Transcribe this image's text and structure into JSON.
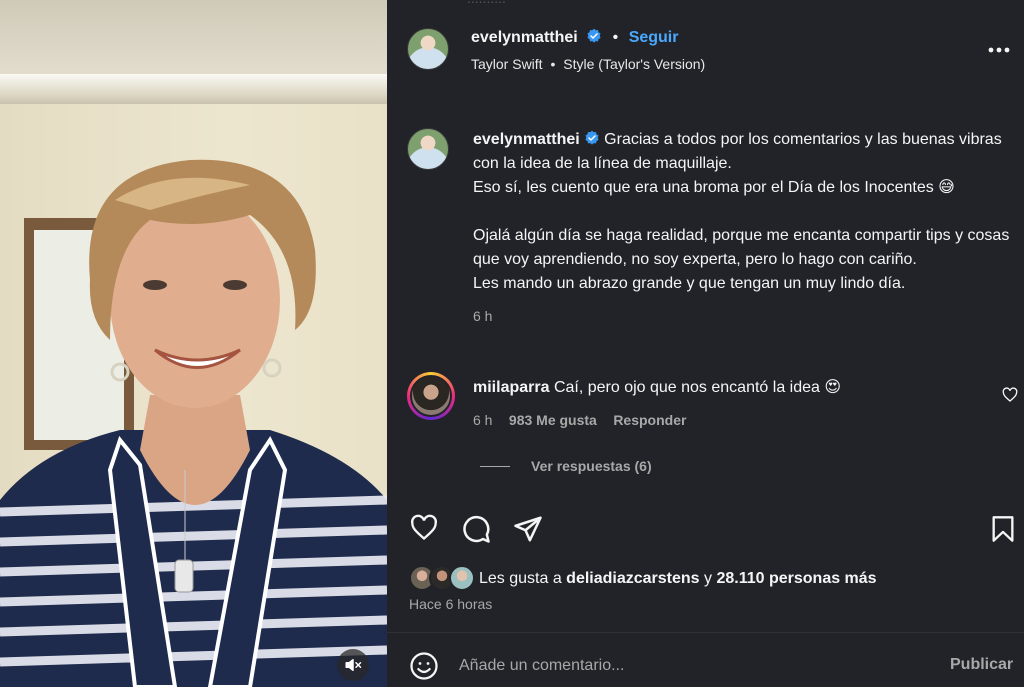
{
  "post": {
    "username": "evelynmatthei",
    "follow_label": "Seguir",
    "dot": "•",
    "music": {
      "artist": "Taylor Swift",
      "separator": "•",
      "track": "Style (Taylor's Version)"
    },
    "caption": {
      "username": "evelynmatthei",
      "line1": "Gracias a todos por los comentarios y las buenas vibras con la idea de la línea de maquillaje.",
      "line2": "Eso sí, les cuento que era una broma por el Día de los Inocentes 😅",
      "line3": "Ojalá algún día se haga realidad, porque me encanta compartir tips y cosas que voy aprendiendo, no soy experta, pero lo hago con cariño.",
      "line4": "Les mando un abrazo grande y que tengan un muy lindo día.",
      "time": "6 h"
    },
    "comment": {
      "username": "miilaparra",
      "text": "Caí, pero ojo que nos encantó la idea 😍",
      "time": "6 h",
      "likes": "983 Me gusta",
      "reply_label": "Responder",
      "view_replies": "Ver respuestas (6)"
    },
    "likes": {
      "prefix": "Les gusta a ",
      "user": "deliadiazcarstens",
      "middle": " y ",
      "count": "28.110 personas más"
    },
    "posted_ago": "Hace 6 horas",
    "composer": {
      "placeholder": "Añade un comentario...",
      "publish_label": "Publicar"
    }
  },
  "icons": {
    "verified": "verified-badge-icon",
    "more": "more-options-icon",
    "like": "heart-icon",
    "comment": "comment-icon",
    "share": "share-icon",
    "save": "bookmark-icon",
    "emoji": "emoji-icon",
    "mute": "muted-speaker-icon",
    "comment_like": "small-heart-icon"
  },
  "colors": {
    "panel_bg": "#212328",
    "link": "#4aa8ff",
    "verified": "#3897f0",
    "muted_text": "#a8a8a8"
  }
}
